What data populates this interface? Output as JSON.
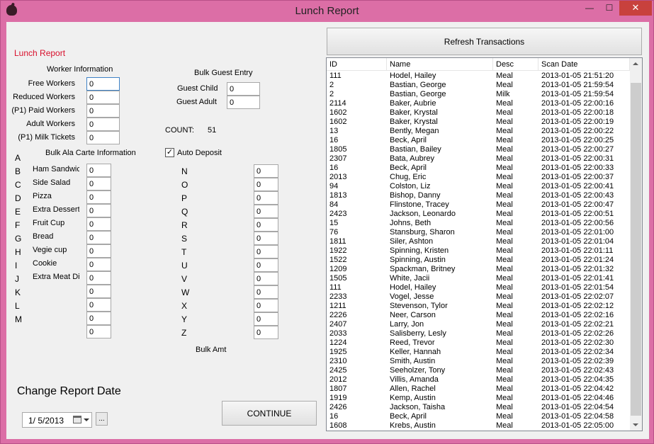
{
  "window": {
    "title": "Lunch Report",
    "minimize": "—",
    "maximize": "☐",
    "close": "✕"
  },
  "form": {
    "section_title": "Lunch Report",
    "worker_info_header": "Worker Information",
    "workers": [
      {
        "label": "Free Workers",
        "value": "0"
      },
      {
        "label": "Reduced Workers",
        "value": "0"
      },
      {
        "label": "(P1) Paid Workers",
        "value": "0"
      },
      {
        "label": "Adult Workers",
        "value": "0"
      },
      {
        "label": "(P1) Milk Tickets",
        "value": "0"
      }
    ],
    "bulk_guest_header": "Bulk Guest Entry",
    "guest_child_label": "Guest Child",
    "guest_child_value": "0",
    "guest_adult_label": "Guest Adult",
    "guest_adult_value": "0",
    "count_label": "COUNT:",
    "count_value": "51",
    "bulk_ala_carte_header": "Bulk Ala Carte Information",
    "auto_deposit_label": "Auto Deposit",
    "auto_deposit_checked": true,
    "letters_left": [
      "A",
      "B",
      "C",
      "D",
      "E",
      "F",
      "G",
      "H",
      "I",
      "J",
      "K",
      "L",
      "M"
    ],
    "ala_carte_items": [
      {
        "label": "Ham Sandwic",
        "value": "0"
      },
      {
        "label": "Side Salad",
        "value": "0"
      },
      {
        "label": "Pizza",
        "value": "0"
      },
      {
        "label": "Extra Dessert",
        "value": "0"
      },
      {
        "label": "Fruit Cup",
        "value": "0"
      },
      {
        "label": "Bread",
        "value": "0"
      },
      {
        "label": "Vegie cup",
        "value": "0"
      },
      {
        "label": "Cookie",
        "value": "0"
      },
      {
        "label": "Extra Meat Di",
        "value": "0"
      },
      {
        "label": "",
        "value": "0"
      },
      {
        "label": "",
        "value": "0"
      },
      {
        "label": "",
        "value": "0"
      },
      {
        "label": "",
        "value": "0"
      }
    ],
    "letters_right": [
      {
        "letter": "N",
        "value": "0"
      },
      {
        "letter": "O",
        "value": "0"
      },
      {
        "letter": "P",
        "value": "0"
      },
      {
        "letter": "Q",
        "value": "0"
      },
      {
        "letter": "R",
        "value": "0"
      },
      {
        "letter": "S",
        "value": "0"
      },
      {
        "letter": "T",
        "value": "0"
      },
      {
        "letter": "U",
        "value": "0"
      },
      {
        "letter": "V",
        "value": "0"
      },
      {
        "letter": "W",
        "value": "0"
      },
      {
        "letter": "X",
        "value": "0"
      },
      {
        "letter": "Y",
        "value": "0"
      },
      {
        "letter": "Z",
        "value": "0"
      }
    ],
    "bulk_amt_label": "Bulk Amt",
    "change_report_date_label": "Change Report Date",
    "report_date": "1/  5/2013",
    "ellipsis_label": "...",
    "continue_label": "CONTINUE",
    "refresh_label": "Refresh Transactions"
  },
  "transactions": {
    "columns": [
      "ID",
      "Name",
      "Desc",
      "Scan Date"
    ],
    "rows": [
      [
        "111",
        "Hodel, Hailey",
        "Meal",
        "2013-01-05 21:51:20"
      ],
      [
        "2",
        "Bastian, George",
        "Meal",
        "2013-01-05 21:59:54"
      ],
      [
        "2",
        "Bastian, George",
        "Milk",
        "2013-01-05 21:59:54"
      ],
      [
        "2114",
        "Baker, Aubrie",
        "Meal",
        "2013-01-05 22:00:16"
      ],
      [
        "1602",
        "Baker, Krystal",
        "Meal",
        "2013-01-05 22:00:18"
      ],
      [
        "1602",
        "Baker, Krystal",
        "Meal",
        "2013-01-05 22:00:19"
      ],
      [
        "13",
        "Bently, Megan",
        "Meal",
        "2013-01-05 22:00:22"
      ],
      [
        "16",
        "Beck, April",
        "Meal",
        "2013-01-05 22:00:25"
      ],
      [
        "1805",
        "Bastian, Bailey",
        "Meal",
        "2013-01-05 22:00:27"
      ],
      [
        "2307",
        "Bata, Aubrey",
        "Meal",
        "2013-01-05 22:00:31"
      ],
      [
        "16",
        "Beck, April",
        "Meal",
        "2013-01-05 22:00:33"
      ],
      [
        "2013",
        "Chug, Eric",
        "Meal",
        "2013-01-05 22:00:37"
      ],
      [
        "94",
        "Colston, Liz",
        "Meal",
        "2013-01-05 22:00:41"
      ],
      [
        "1813",
        "Bishop, Danny",
        "Meal",
        "2013-01-05 22:00:43"
      ],
      [
        "84",
        "Flinstone, Tracey",
        "Meal",
        "2013-01-05 22:00:47"
      ],
      [
        "2423",
        "Jackson, Leonardo",
        "Meal",
        "2013-01-05 22:00:51"
      ],
      [
        "15",
        "Johns, Beth",
        "Meal",
        "2013-01-05 22:00:56"
      ],
      [
        "76",
        "Stansburg, Sharon",
        "Meal",
        "2013-01-05 22:01:00"
      ],
      [
        "1811",
        "Siler, Ashton",
        "Meal",
        "2013-01-05 22:01:04"
      ],
      [
        "1922",
        "Spinning, Kristen",
        "Meal",
        "2013-01-05 22:01:11"
      ],
      [
        "1522",
        "Spinning, Austin",
        "Meal",
        "2013-01-05 22:01:24"
      ],
      [
        "1209",
        "Spackman, Britney",
        "Meal",
        "2013-01-05 22:01:32"
      ],
      [
        "1505",
        "White, Jacii",
        "Meal",
        "2013-01-05 22:01:41"
      ],
      [
        "111",
        "Hodel, Hailey",
        "Meal",
        "2013-01-05 22:01:54"
      ],
      [
        "2233",
        "Vogel, Jesse",
        "Meal",
        "2013-01-05 22:02:07"
      ],
      [
        "1211",
        "Stevenson, Tylor",
        "Meal",
        "2013-01-05 22:02:12"
      ],
      [
        "2226",
        "Neer, Carson",
        "Meal",
        "2013-01-05 22:02:16"
      ],
      [
        "2407",
        "Larry, Jon",
        "Meal",
        "2013-01-05 22:02:21"
      ],
      [
        "2033",
        "Salisberry, Lesly",
        "Meal",
        "2013-01-05 22:02:26"
      ],
      [
        "1224",
        "Reed, Trevor",
        "Meal",
        "2013-01-05 22:02:30"
      ],
      [
        "1925",
        "Keller, Hannah",
        "Meal",
        "2013-01-05 22:02:34"
      ],
      [
        "2310",
        "Smith, Austin",
        "Meal",
        "2013-01-05 22:02:39"
      ],
      [
        "2425",
        "Seeholzer, Tony",
        "Meal",
        "2013-01-05 22:02:43"
      ],
      [
        "2012",
        "Villis, Amanda",
        "Meal",
        "2013-01-05 22:04:35"
      ],
      [
        "1807",
        "Allen, Rachel",
        "Meal",
        "2013-01-05 22:04:42"
      ],
      [
        "1919",
        "Kemp, Austin",
        "Meal",
        "2013-01-05 22:04:46"
      ],
      [
        "2426",
        "Jackson, Taisha",
        "Meal",
        "2013-01-05 22:04:54"
      ],
      [
        "16",
        "Beck, April",
        "Meal",
        "2013-01-05 22:04:58"
      ],
      [
        "1608",
        "Krebs, Austin",
        "Meal",
        "2013-01-05 22:05:00"
      ]
    ]
  }
}
